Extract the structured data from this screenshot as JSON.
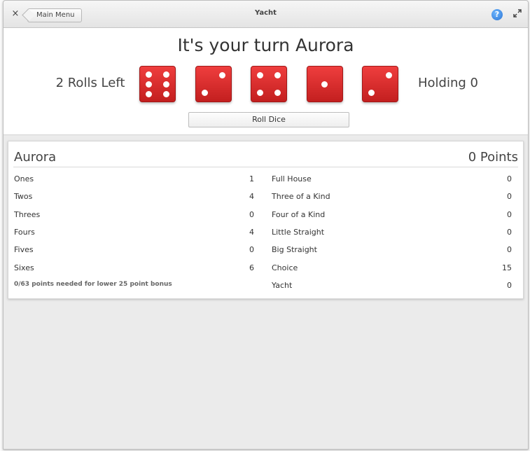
{
  "window": {
    "title": "Yacht",
    "back_label": "Main Menu",
    "close_glyph": "×",
    "help_glyph": "?"
  },
  "turn": {
    "heading": "It's your turn Aurora",
    "rolls_left": "2 Rolls Left",
    "holding": "Holding 0",
    "roll_button": "Roll Dice"
  },
  "dice": [
    6,
    2,
    4,
    1,
    2
  ],
  "scorecard": {
    "player": "Aurora",
    "points": "0 Points",
    "upper": [
      {
        "label": "Ones",
        "value": "1"
      },
      {
        "label": "Twos",
        "value": "4"
      },
      {
        "label": "Threes",
        "value": "0"
      },
      {
        "label": "Fours",
        "value": "4"
      },
      {
        "label": "Fives",
        "value": "0"
      },
      {
        "label": "Sixes",
        "value": "6"
      }
    ],
    "lower": [
      {
        "label": "Full House",
        "value": "0"
      },
      {
        "label": "Three of a Kind",
        "value": "0"
      },
      {
        "label": "Four of a Kind",
        "value": "0"
      },
      {
        "label": "Little Straight",
        "value": "0"
      },
      {
        "label": "Big Straight",
        "value": "0"
      },
      {
        "label": "Choice",
        "value": "15"
      },
      {
        "label": "Yacht",
        "value": "0"
      }
    ],
    "bonus_note": "0/63 points needed for lower 25 point bonus"
  },
  "colors": {
    "die": "#d92a2a",
    "accent": "#2a74d4"
  }
}
